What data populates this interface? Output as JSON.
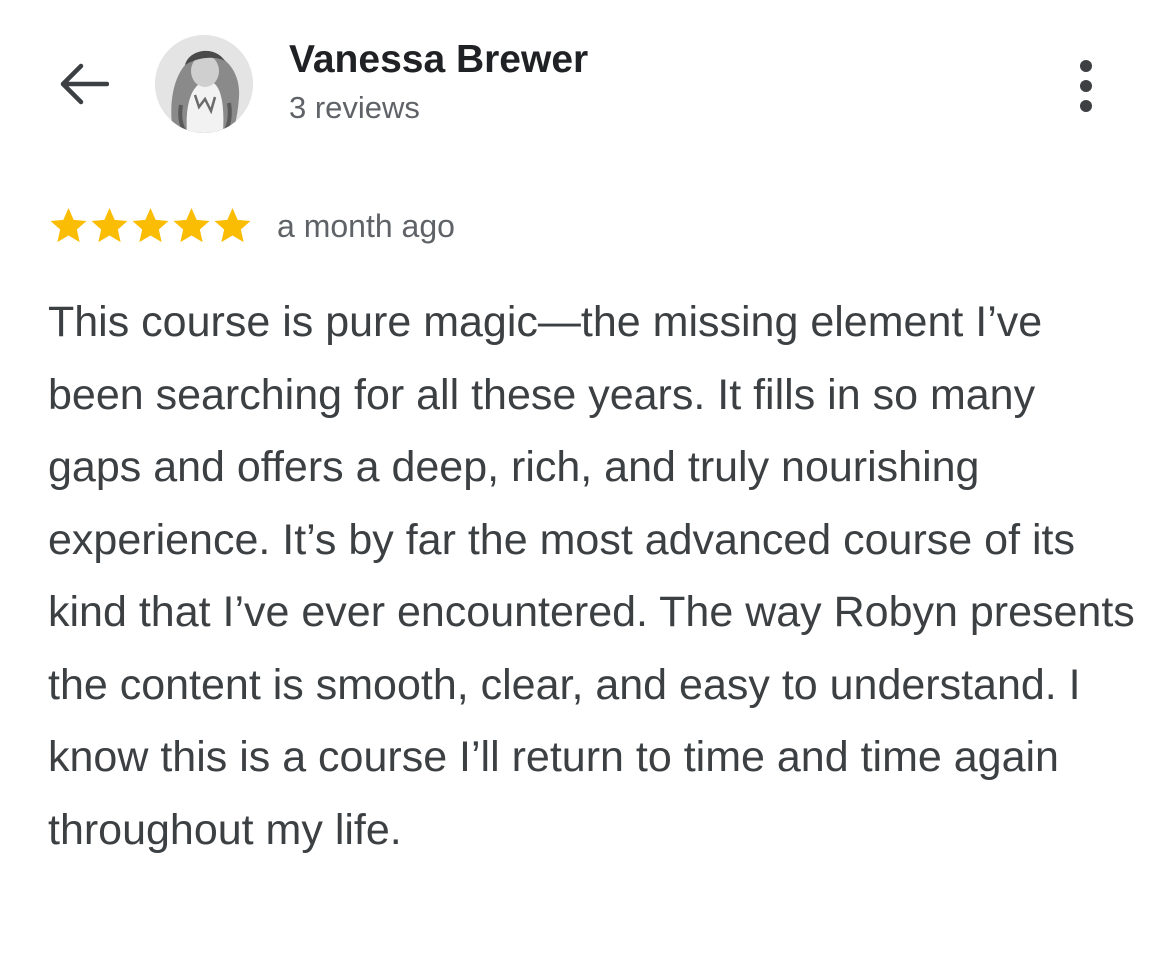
{
  "header": {
    "back_icon": "arrow-left-icon",
    "avatar_icon": "user-avatar-photo",
    "user_name": "Vanessa Brewer",
    "review_count": "3 reviews",
    "more_icon": "more-vert-icon"
  },
  "review": {
    "rating": 5,
    "rating_max": 5,
    "star_color": "#fbbc04",
    "date": "a month ago",
    "text": "This course is pure magic—the missing element I’ve been searching for all these years. It fills in so many gaps and offers a deep, rich, and truly nourishing experience. It’s by far the most advanced course of its kind that I’ve ever encountered. The way Robyn presents the content is smooth, clear, and easy to understand. I know this is a course I’ll return to time and time again throughout my life."
  }
}
